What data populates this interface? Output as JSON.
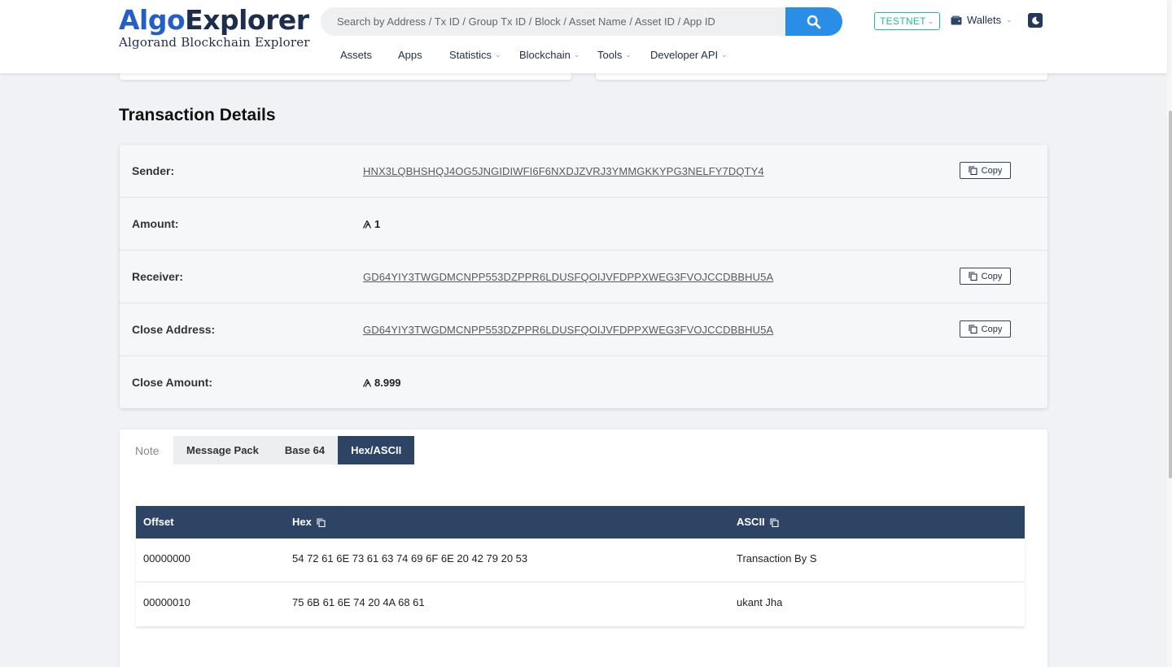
{
  "header": {
    "logo_algo": "Algo",
    "logo_explorer": "Explorer",
    "logo_subtitle": "Algorand Blockchain Explorer",
    "search_placeholder": "Search by Address / Tx ID / Group Tx ID / Block / Asset Name / Asset ID / App ID",
    "network": "TESTNET",
    "wallets": "Wallets",
    "nav": [
      "Assets",
      "Apps",
      "Statistics",
      "Blockchain",
      "Tools",
      "Developer API"
    ]
  },
  "page": {
    "title": "Transaction Details"
  },
  "details": {
    "rows": [
      {
        "label": "Sender:",
        "value": "HNX3LQBHSHQJ4OG5JNGIDIWFI6F6NXDJZVRJ3YMMGKKYPG3NELFY7DQTY4"
      },
      {
        "label": "Amount:",
        "value": "1"
      },
      {
        "label": "Receiver:",
        "value": "GD64YIY3TWGDMCNPP553DZPPR6LDUSFQOIJVFDPPXWEG3FVOJCCDBBHU5A"
      },
      {
        "label": "Close Address:",
        "value": "GD64YIY3TWGDMCNPP553DZPPR6LDUSFQOIJVFDPPXWEG3FVOJCCDBBHU5A"
      },
      {
        "label": "Close Amount:",
        "value": "8.999"
      }
    ],
    "copy_label": "Copy"
  },
  "note": {
    "label": "Note",
    "tabs": [
      "Message Pack",
      "Base 64",
      "Hex/ASCII"
    ],
    "active_tab": "Hex/ASCII",
    "columns": [
      "Offset",
      "Hex",
      "ASCII"
    ],
    "rows": [
      {
        "offset": "00000000",
        "hex": "54 72 61 6E 73 61 63 74 69 6F 6E 20 42 79 20 53",
        "ascii": "Transaction By S"
      },
      {
        "offset": "00000010",
        "hex": "75 6B 61 6E 74 20 4A 68 61",
        "ascii": "ukant Jha"
      }
    ]
  },
  "colors": {
    "brand_blue": "#245ec8",
    "navy": "#2d4464",
    "testnet_green": "#1fbf9a",
    "search_blue": "#2b8ee6"
  },
  "icons": [
    "search-icon",
    "wallet-icon",
    "moon-icon",
    "copy-icon",
    "algo-icon",
    "chevron-down-icon"
  ]
}
